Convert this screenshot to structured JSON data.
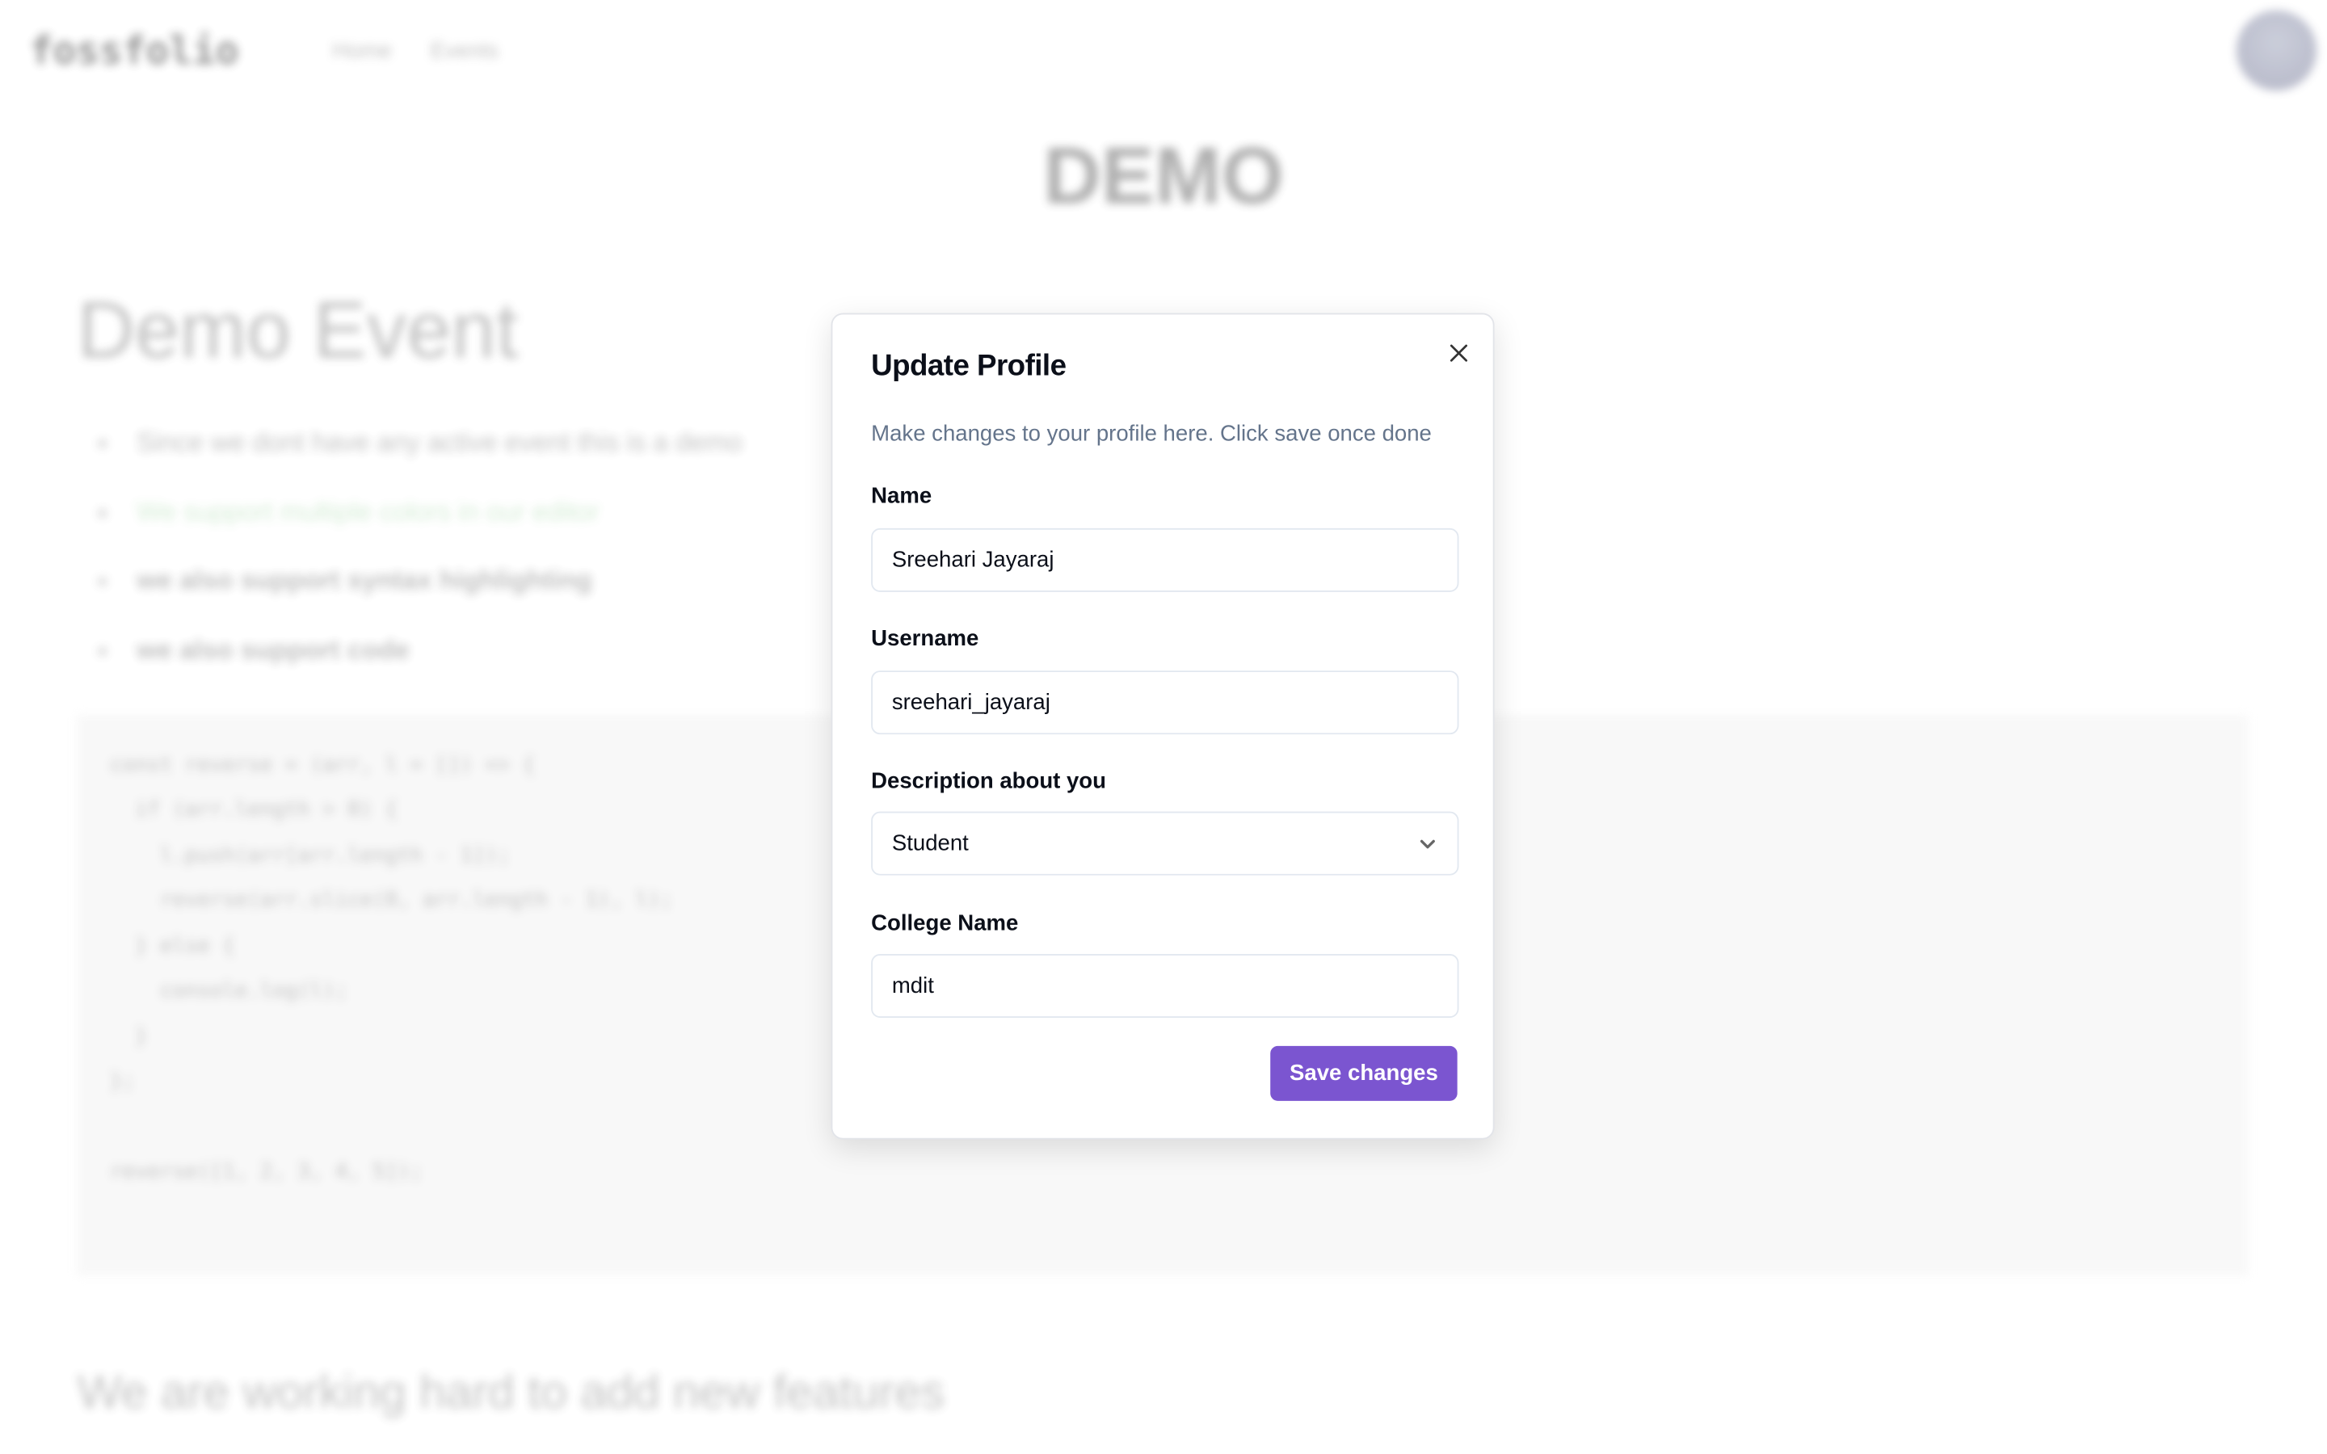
{
  "header": {
    "logo": "fossfolio",
    "nav": [
      "Home",
      "Events"
    ]
  },
  "page": {
    "banner": "DEMO",
    "title": "Demo Event",
    "bullets": [
      "Since we dont have any active event this is a demo",
      "We support multiple colors in our editor",
      "we also support syntax highlighting",
      "we also support code"
    ],
    "bullet_colors": {
      "green": "#6fbf73"
    },
    "code": [
      "const reverse = (arr, l = []) => {",
      "  if (arr.length > 0) {",
      "    l.push(arr[arr.length - 1]);",
      "    reverse(arr.slice(0, arr.length - 1), l);",
      "  } else {",
      "    console.log(l);",
      "  }",
      "};",
      "",
      "reverse([1, 2, 3, 4, 5]);"
    ],
    "footer": "We are working hard to add new features"
  },
  "modal": {
    "title": "Update Profile",
    "description": "Make changes to your profile here. Click save once done",
    "close_icon": "close-icon",
    "fields": {
      "name": {
        "label": "Name",
        "value": "Sreehari Jayaraj"
      },
      "username": {
        "label": "Username",
        "value": "sreehari_jayaraj"
      },
      "description": {
        "label": "Description about you",
        "value": "Student"
      },
      "college": {
        "label": "College Name",
        "value": "mdit"
      }
    },
    "save_label": "Save changes",
    "accent": "#7b55d0"
  }
}
